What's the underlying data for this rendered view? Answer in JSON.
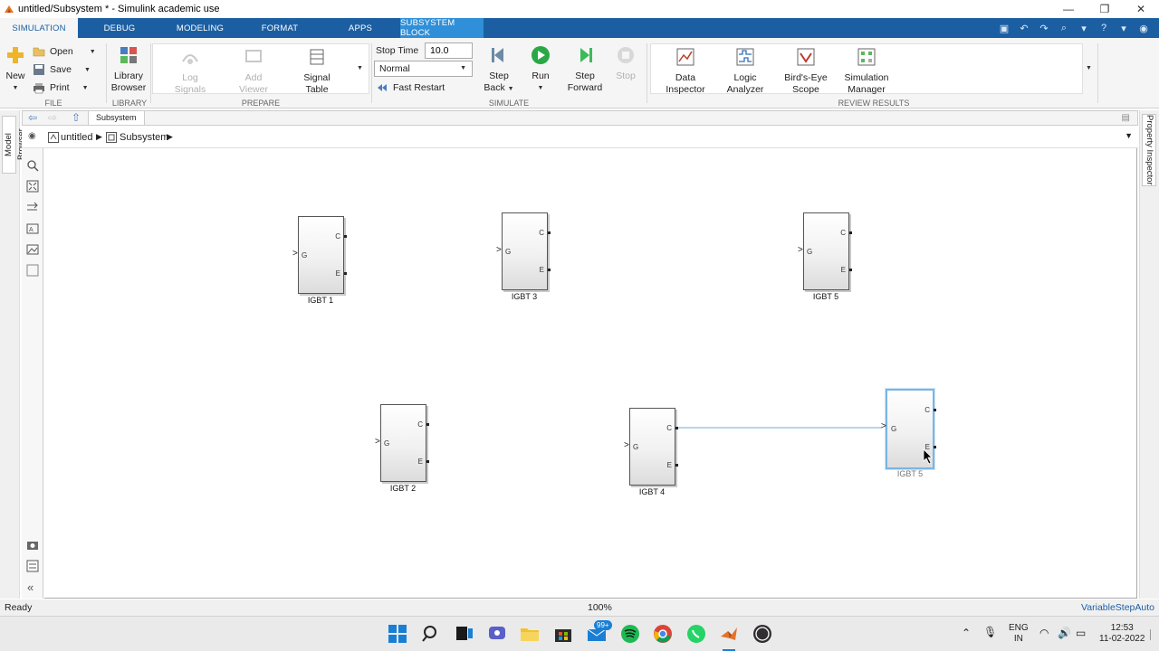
{
  "window": {
    "title": "untitled/Subsystem * - Simulink academic use",
    "minimize": "—",
    "restore": "❐",
    "close": "✕"
  },
  "tabs": [
    {
      "label": "SIMULATION",
      "state": "active"
    },
    {
      "label": "DEBUG",
      "state": "normal"
    },
    {
      "label": "MODELING",
      "state": "normal"
    },
    {
      "label": "FORMAT",
      "state": "normal"
    },
    {
      "label": "APPS",
      "state": "normal"
    },
    {
      "label": "SUBSYSTEM BLOCK",
      "state": "contextual"
    }
  ],
  "ribbon": {
    "file": {
      "label": "FILE",
      "new": "New",
      "open": "Open",
      "save": "Save",
      "print": "Print"
    },
    "library": {
      "label": "LIBRARY",
      "browser_line1": "Library",
      "browser_line2": "Browser"
    },
    "prepare": {
      "label": "PREPARE",
      "log_signals_1": "Log",
      "log_signals_2": "Signals",
      "add_viewer_1": "Add",
      "add_viewer_2": "Viewer",
      "signal_table_1": "Signal",
      "signal_table_2": "Table"
    },
    "simulate": {
      "label": "SIMULATE",
      "stop_time_label": "Stop Time",
      "stop_time_value": "10.0",
      "mode": "Normal",
      "fast_restart": "Fast Restart",
      "step_back_1": "Step",
      "step_back_2": "Back",
      "run": "Run",
      "step_forward_1": "Step",
      "step_forward_2": "Forward",
      "stop": "Stop"
    },
    "review": {
      "label": "REVIEW RESULTS",
      "data_inspector_1": "Data",
      "data_inspector_2": "Inspector",
      "logic_analyzer_1": "Logic",
      "logic_analyzer_2": "Analyzer",
      "birds_eye_1": "Bird's-Eye",
      "birds_eye_2": "Scope",
      "sim_manager_1": "Simulation",
      "sim_manager_2": "Manager"
    }
  },
  "docks": {
    "left": "Model Browser",
    "right": "Property Inspector"
  },
  "editor": {
    "tab_label": "Subsystem",
    "breadcrumb": [
      "untitled",
      "Subsystem"
    ]
  },
  "blocks": [
    {
      "name": "IGBT 1",
      "port_g": "G",
      "port_c": "C",
      "port_e": "E",
      "selected": false
    },
    {
      "name": "IGBT 3",
      "port_g": "G",
      "port_c": "C",
      "port_e": "E",
      "selected": false
    },
    {
      "name": "IGBT 5",
      "port_g": "G",
      "port_c": "C",
      "port_e": "E",
      "selected": false
    },
    {
      "name": "IGBT 2",
      "port_g": "G",
      "port_c": "C",
      "port_e": "E",
      "selected": false
    },
    {
      "name": "IGBT 4",
      "port_g": "G",
      "port_c": "C",
      "port_e": "E",
      "selected": false
    },
    {
      "name": "IGBT 5",
      "port_g": "G",
      "port_c": "C",
      "port_e": "E",
      "selected": true
    }
  ],
  "status": {
    "left": "Ready",
    "zoom": "100%",
    "solver": "VariableStepAuto"
  },
  "taskbar": {
    "badge": "99+",
    "lang_1": "ENG",
    "lang_2": "IN",
    "time": "12:53",
    "date": "11-02-2022"
  },
  "colors": {
    "tab_strip": "#1b5fa2",
    "contextual_tab": "#2f8fd8",
    "selection": "#7ab5e3",
    "run_green": "#2aa845"
  }
}
